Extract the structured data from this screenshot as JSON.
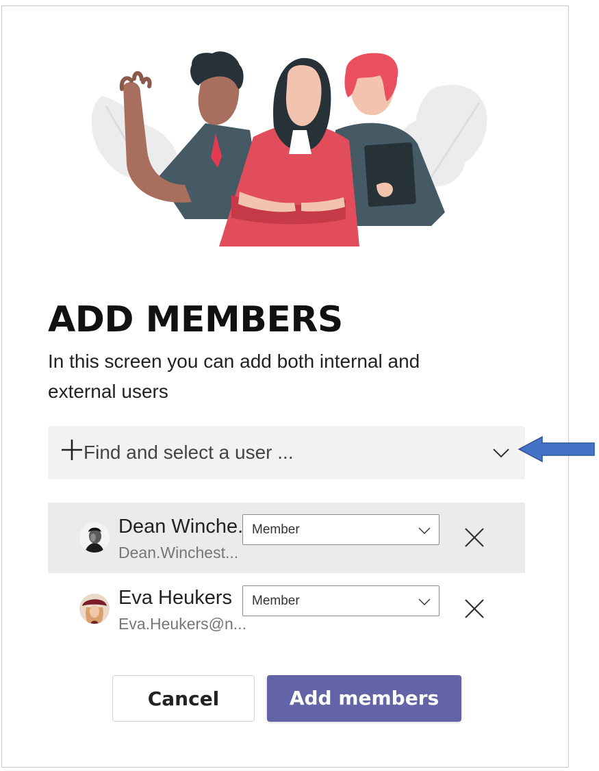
{
  "dialog": {
    "title": "ADD MEMBERS",
    "subtitle": "In this screen you can add both internal and external users"
  },
  "search": {
    "placeholder": "Find and select a user ...",
    "icon": "plus-icon",
    "dropdown_icon": "chevron-down-icon"
  },
  "annotation": {
    "icon": "arrow-left-icon",
    "color": "#4472c4"
  },
  "members": [
    {
      "name": "Dean Winche...",
      "email": "Dean.Winchest...",
      "role": "Member",
      "selected": true
    },
    {
      "name": "Eva Heukers",
      "email": "Eva.Heukers@n...",
      "role": "Member",
      "selected": false
    }
  ],
  "actions": {
    "cancel_label": "Cancel",
    "add_label": "Add members"
  },
  "colors": {
    "primary": "#6264a7",
    "search_bg": "#f3f2f1",
    "selected_row_bg": "#ebebeb"
  }
}
